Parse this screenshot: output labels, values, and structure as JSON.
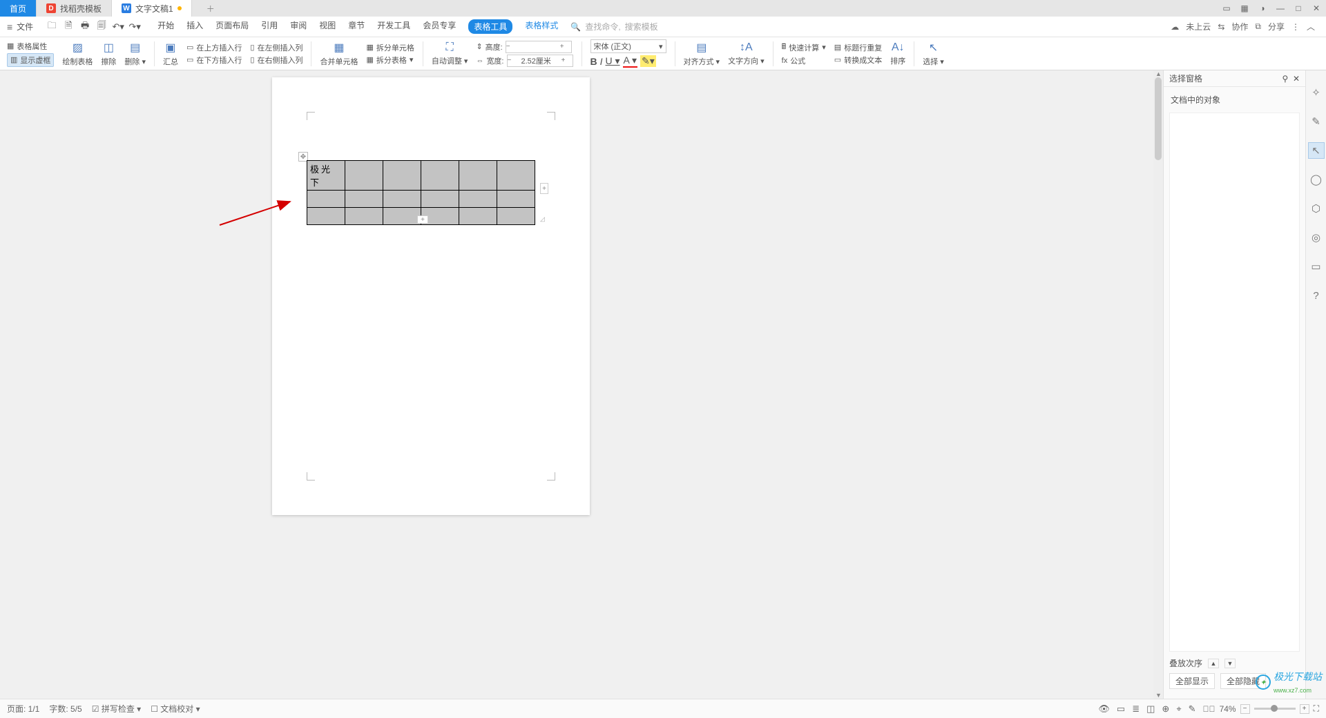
{
  "tabs": {
    "home": "首页",
    "template": "找稻壳模板",
    "doc": "文字文稿1"
  },
  "menu": {
    "file": "文件",
    "items": [
      "开始",
      "插入",
      "页面布局",
      "引用",
      "审阅",
      "视图",
      "章节",
      "开发工具",
      "会员专享"
    ],
    "tableTool": "表格工具",
    "tableStyle": "表格样式",
    "searchCmd": "查找命令,",
    "searchTpl": "搜索模板",
    "cloud": "未上云",
    "collab": "协作",
    "share": "分享"
  },
  "ribbon": {
    "tableProps": "表格属性",
    "showBorder": "显示虚框",
    "drawTable": "绘制表格",
    "erase": "擦除",
    "delete": "删除",
    "summary": "汇总",
    "insAbove": "在上方插入行",
    "insBelow": "在下方插入行",
    "insLeft": "在左侧插入列",
    "insRight": "在右侧插入列",
    "mergeCells": "合并单元格",
    "splitCells": "拆分单元格",
    "splitTable": "拆分表格",
    "autofit": "自动调整",
    "heightLbl": "高度:",
    "widthLbl": "宽度:",
    "heightVal": "",
    "widthVal": "2.52厘米",
    "font": "宋体 (正文)",
    "align": "对齐方式",
    "textDir": "文字方向",
    "fastCalc": "快速计算",
    "formula": "公式",
    "repeatHdr": "标题行重复",
    "toText": "转换成文本",
    "sort": "排序",
    "select": "选择"
  },
  "table": {
    "cell11": "极光下"
  },
  "panel": {
    "title": "选择窗格",
    "objects": "文档中的对象",
    "stack": "叠放次序",
    "showAll": "全部显示",
    "hideAll": "全部隐藏"
  },
  "status": {
    "page": "页面: 1/1",
    "words": "字数: 5/5",
    "spell": "拼写检查",
    "content": "文档校对",
    "zoom": "74%"
  },
  "watermark": {
    "name": "极光下载站",
    "url": "www.xz7.com"
  }
}
